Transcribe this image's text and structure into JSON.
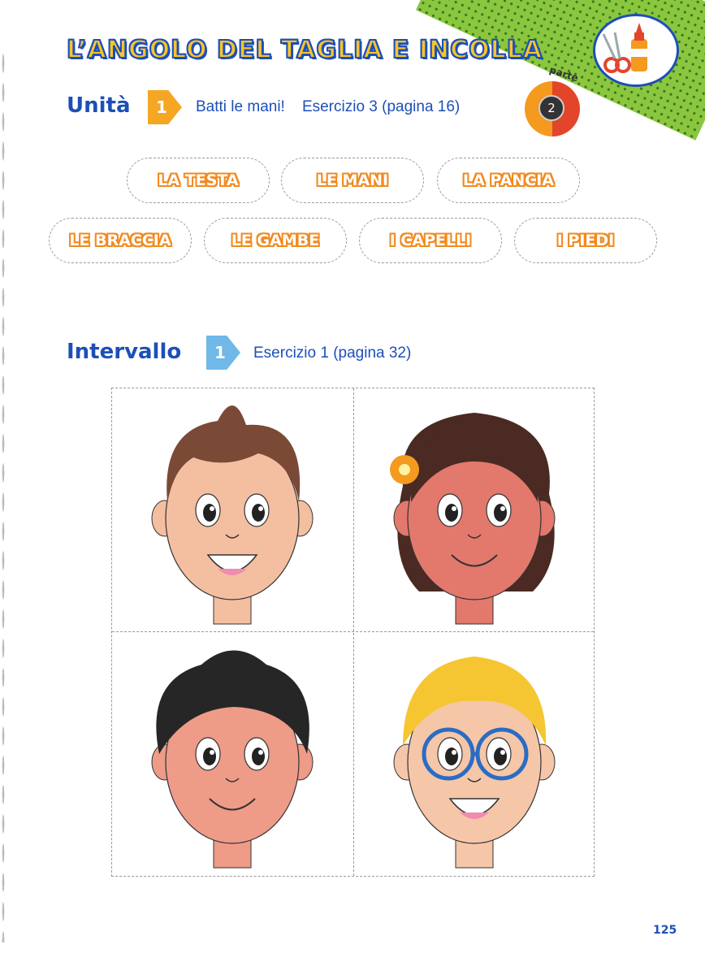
{
  "header": {
    "title": "L’ANGOLO DEL TAGLIA E INCOLLA",
    "icon": "scissors-and-glue-icon"
  },
  "unit_section": {
    "heading": "Unità",
    "number": "1",
    "exercise": "Batti le mani!    Esercizio 3 (pagina 16)",
    "part_label": "parte",
    "part_number": "2"
  },
  "word_cards": [
    "LA TESTA",
    "LE MANI",
    "LA PANCIA",
    "LE BRACCIA",
    "LE GAMBE",
    "I CAPELLI",
    "I PIEDI"
  ],
  "interval_section": {
    "heading": "Intervallo",
    "number": "1",
    "exercise": "Esercizio 1 (pagina 32)"
  },
  "faces": [
    {
      "name": "boy-brown-hair-face",
      "hair": "#7a4a36",
      "skin": "#f4bfa1"
    },
    {
      "name": "girl-curly-hair-face",
      "hair": "#4a2a22",
      "skin": "#e3786d"
    },
    {
      "name": "boy-black-curly-hair-face",
      "hair": "#262626",
      "skin": "#ee9b88"
    },
    {
      "name": "boy-blond-glasses-face",
      "hair": "#f5c631",
      "skin": "#f6c6a8"
    }
  ],
  "page_number": "125",
  "colors": {
    "accent_blue": "#1d4fb8",
    "accent_orange": "#f28a1e",
    "green": "#8cc63f"
  }
}
